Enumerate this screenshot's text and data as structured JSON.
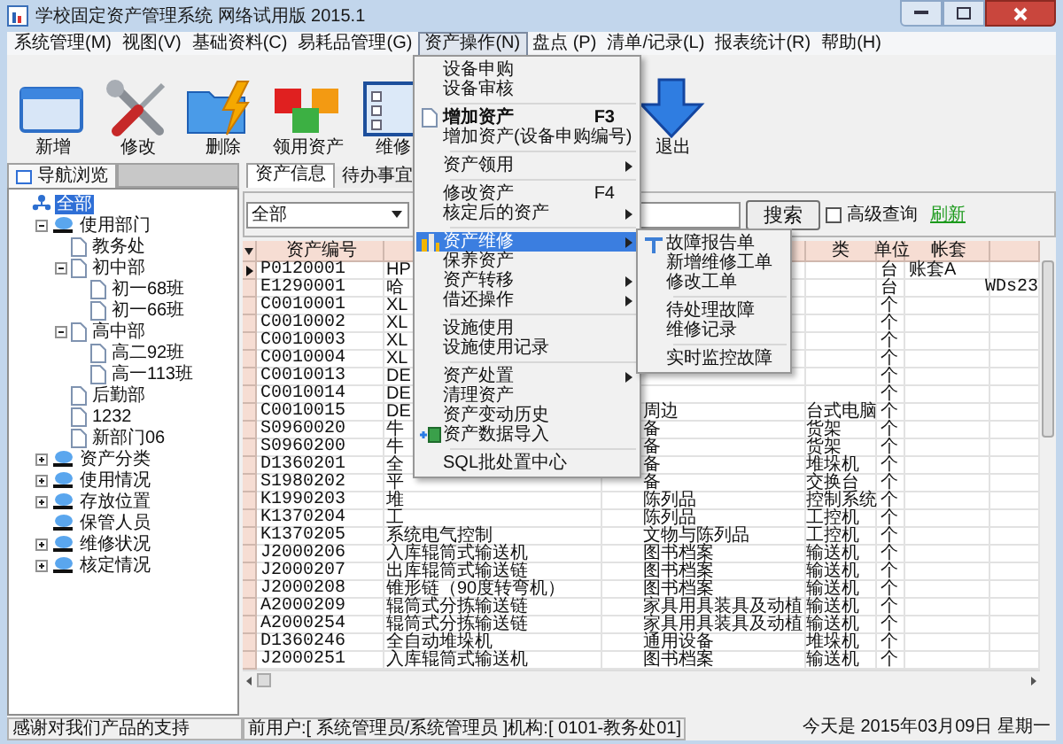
{
  "window": {
    "title": "学校固定资产管理系统 网络试用版 2015.1"
  },
  "menubar": [
    {
      "label": "系统管理(M)",
      "selected": false
    },
    {
      "label": "视图(V)",
      "selected": false
    },
    {
      "label": "基础资料(C)",
      "selected": false
    },
    {
      "label": "易耗品管理(G)",
      "selected": false
    },
    {
      "label": "资产操作(N)",
      "selected": true
    },
    {
      "label": "盘点 (P)",
      "selected": false
    },
    {
      "label": "清单/记录(L)",
      "selected": false
    },
    {
      "label": "报表统计(R)",
      "selected": false
    },
    {
      "label": "帮助(H)",
      "selected": false
    }
  ],
  "toolbar": [
    {
      "kind": "window",
      "label": "新增"
    },
    {
      "kind": "tools",
      "label": "修改"
    },
    {
      "kind": "folder",
      "label": "删除"
    },
    {
      "kind": "cubes",
      "label": "领用资产"
    },
    {
      "kind": "list",
      "label": "维修"
    },
    {
      "kind": "exit",
      "label": "退出"
    }
  ],
  "navigator": {
    "tab": "导航浏览",
    "tree": [
      {
        "kind": "root",
        "label": "全部",
        "selected": true,
        "children": [
          {
            "kind": "group",
            "label": "使用部门",
            "expanded": true,
            "selected": false,
            "children": [
              {
                "kind": "page",
                "label": "教务处",
                "selected": false
              },
              {
                "kind": "page",
                "label": "初中部",
                "expanded": true,
                "selected": false,
                "children": [
                  {
                    "kind": "page",
                    "label": "初一68班",
                    "selected": false
                  },
                  {
                    "kind": "page",
                    "label": "初一66班",
                    "selected": false
                  }
                ]
              },
              {
                "kind": "page",
                "label": "高中部",
                "expanded": true,
                "selected": false,
                "children": [
                  {
                    "kind": "page",
                    "label": "高二92班",
                    "selected": false
                  },
                  {
                    "kind": "page",
                    "label": "高一113班",
                    "selected": false
                  }
                ]
              },
              {
                "kind": "page",
                "label": "后勤部",
                "selected": false
              },
              {
                "kind": "page",
                "label": "1232",
                "selected": false
              },
              {
                "kind": "page",
                "label": "新部门06",
                "selected": false
              }
            ]
          },
          {
            "kind": "group",
            "label": "资产分类",
            "expanded": false,
            "selected": false
          },
          {
            "kind": "group",
            "label": "使用情况",
            "expanded": false,
            "selected": false
          },
          {
            "kind": "group",
            "label": "存放位置",
            "expanded": false,
            "selected": false
          },
          {
            "kind": "group",
            "label": "保管人员",
            "selected": false
          },
          {
            "kind": "group",
            "label": "维修状况",
            "expanded": false,
            "selected": false
          },
          {
            "kind": "group",
            "label": "核定情况",
            "expanded": false,
            "selected": false
          }
        ]
      }
    ]
  },
  "content": {
    "tabs": [
      {
        "label": "资产信息",
        "selected": true
      },
      {
        "label": "待办事宜",
        "selected": false
      }
    ],
    "filter": {
      "scope": "全部",
      "search_button": "搜索",
      "advanced": {
        "label": "高级查询",
        "checked": false
      },
      "refresh_link": "刷新"
    },
    "table": {
      "header": {
        "asset_no": "资产编号",
        "column_4": "类",
        "unit": "单位",
        "account": "帐套"
      },
      "rows": [
        {
          "selected": true,
          "asset_no": "P0120001",
          "column_2": "HP",
          "unit": "台",
          "account": "账套A"
        },
        {
          "selected": false,
          "asset_no": "E1290001",
          "column_2": "哈",
          "unit": "台",
          "column_7": "WDs23"
        },
        {
          "selected": false,
          "asset_no": "C0010001",
          "column_2": "XL",
          "unit": "个"
        },
        {
          "selected": false,
          "asset_no": "C0010002",
          "column_2": "XL",
          "unit": "个"
        },
        {
          "selected": false,
          "asset_no": "C0010003",
          "column_2": "XL",
          "unit": "个"
        },
        {
          "selected": false,
          "asset_no": "C0010004",
          "column_2": "XL",
          "unit": "个"
        },
        {
          "selected": false,
          "asset_no": "C0010013",
          "column_2": "DE",
          "unit": "个"
        },
        {
          "selected": false,
          "asset_no": "C0010014",
          "column_2": "DE",
          "unit": "个"
        },
        {
          "selected": false,
          "asset_no": "C0010015",
          "column_2": "DE",
          "column_3": "周边",
          "column_4": "台式电脑",
          "unit": "个"
        },
        {
          "selected": false,
          "asset_no": "S0960020",
          "column_2": "牛",
          "column_3": "备",
          "column_4": "货架",
          "unit": "个"
        },
        {
          "selected": false,
          "asset_no": "S0960200",
          "column_2": "牛",
          "column_3": "备",
          "column_4": "货架",
          "unit": "个"
        },
        {
          "selected": false,
          "asset_no": "D1360201",
          "column_2": "全",
          "column_3": "备",
          "column_4": "堆垛机",
          "unit": "个"
        },
        {
          "selected": false,
          "asset_no": "S1980202",
          "column_2": "平",
          "column_3": "备",
          "column_4": "交换台",
          "unit": "个"
        },
        {
          "selected": false,
          "asset_no": "K1990203",
          "column_2": "堆",
          "column_3": "陈列品",
          "column_4": "控制系统",
          "unit": "个"
        },
        {
          "selected": false,
          "asset_no": "K1370204",
          "column_2": "工",
          "column_3": "陈列品",
          "column_4": "工控机",
          "unit": "个"
        },
        {
          "selected": false,
          "asset_no": "K1370205",
          "column_2": "系统电气控制",
          "column_3": "文物与陈列品",
          "column_4": "工控机",
          "unit": "个"
        },
        {
          "selected": false,
          "asset_no": "J2000206",
          "column_2": "入库辊筒式输送机",
          "column_3": "图书档案",
          "column_4": "输送机",
          "unit": "个"
        },
        {
          "selected": false,
          "asset_no": "J2000207",
          "column_2": "出库辊筒式输送链",
          "column_3": "图书档案",
          "column_4": "输送机",
          "unit": "个"
        },
        {
          "selected": false,
          "asset_no": "J2000208",
          "column_2": "锥形链（90度转弯机）",
          "column_3": "图书档案",
          "column_4": "输送机",
          "unit": "个"
        },
        {
          "selected": false,
          "asset_no": "A2000209",
          "column_2": "辊筒式分拣输送链",
          "column_3": "家具用具装具及动植",
          "column_4": "输送机",
          "unit": "个"
        },
        {
          "selected": false,
          "asset_no": "A2000254",
          "column_2": "辊筒式分拣输送链",
          "column_3": "家具用具装具及动植",
          "column_4": "输送机",
          "unit": "个"
        },
        {
          "selected": false,
          "asset_no": "D1360246",
          "column_2": "全自动堆垛机",
          "column_3": "通用设备",
          "column_4": "堆垛机",
          "unit": "个"
        },
        {
          "selected": false,
          "asset_no": "J2000251",
          "column_2": "入库辊筒式输送机",
          "column_3": "图书档案",
          "column_4": "输送机",
          "unit": "个"
        }
      ]
    }
  },
  "menu": {
    "items": [
      {
        "kind": "plain",
        "label": "设备申购",
        "arrow": false,
        "selected": false
      },
      {
        "kind": "plain",
        "label": "设备审核",
        "arrow": false,
        "selected": false
      },
      {
        "kind": "separator"
      },
      {
        "kind": "document",
        "label": "增加资产",
        "bold": true,
        "shortcut": "F3",
        "arrow": false,
        "selected": false
      },
      {
        "kind": "plain",
        "label": "增加资产(设备申购编号)",
        "arrow": false,
        "selected": false
      },
      {
        "kind": "separator"
      },
      {
        "kind": "plain",
        "label": "资产领用",
        "arrow": true,
        "selected": false
      },
      {
        "kind": "separator"
      },
      {
        "kind": "plain",
        "label": "修改资产",
        "shortcut": "F4",
        "arrow": false,
        "selected": false
      },
      {
        "kind": "plain",
        "label": "核定后的资产",
        "arrow": true,
        "selected": false
      },
      {
        "kind": "separator"
      },
      {
        "kind": "chart",
        "label": "资产维修",
        "arrow": true,
        "selected": true
      },
      {
        "kind": "plain",
        "label": "保养资产",
        "arrow": false,
        "selected": false
      },
      {
        "kind": "plain",
        "label": "资产转移",
        "arrow": true,
        "selected": false
      },
      {
        "kind": "plain",
        "label": "借还操作",
        "arrow": true,
        "selected": false
      },
      {
        "kind": "separator"
      },
      {
        "kind": "plain",
        "label": "设施使用",
        "arrow": false,
        "selected": false
      },
      {
        "kind": "plain",
        "label": "设施使用记录",
        "arrow": false,
        "selected": false
      },
      {
        "kind": "separator"
      },
      {
        "kind": "plain",
        "label": "资产处置",
        "arrow": true,
        "selected": false
      },
      {
        "kind": "plain",
        "label": "清理资产",
        "arrow": false,
        "selected": false
      },
      {
        "kind": "plain",
        "label": "资产变动历史",
        "arrow": false,
        "selected": false
      },
      {
        "kind": "import",
        "label": "资产数据导入",
        "arrow": false,
        "selected": false
      },
      {
        "kind": "separator"
      },
      {
        "kind": "plain",
        "label": "SQL批处置中心",
        "arrow": false,
        "selected": false
      }
    ]
  },
  "submenu": {
    "items": [
      {
        "kind": "tool",
        "label": "故障报告单",
        "selected": false
      },
      {
        "kind": "plain",
        "label": "新增维修工单",
        "selected": false
      },
      {
        "kind": "plain",
        "label": "修改工单",
        "selected": false
      },
      {
        "kind": "separator"
      },
      {
        "kind": "plain",
        "label": "待处理故障",
        "selected": false
      },
      {
        "kind": "plain",
        "label": "维修记录",
        "selected": false
      },
      {
        "kind": "separator"
      },
      {
        "kind": "plain",
        "label": "实时监控故障",
        "selected": false
      }
    ]
  },
  "status_bar": {
    "message": "感谢对我们产品的支持",
    "user": "前用户:[ 系统管理员/系统管理员 ]机构:[ 0101-教务处01]",
    "date": "今天是 2015年03月09日 星期一"
  }
}
